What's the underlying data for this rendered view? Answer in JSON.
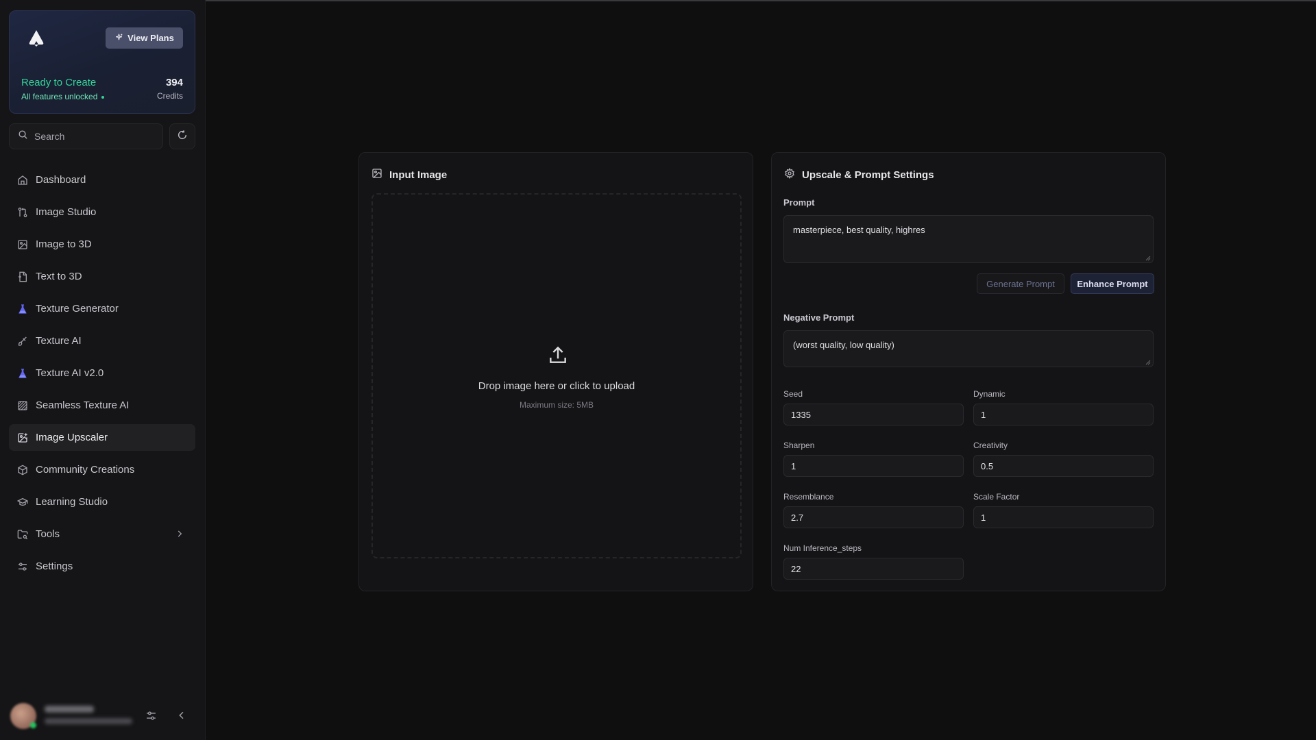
{
  "sidebar": {
    "plan": {
      "view_plans_label": "View Plans",
      "status_title": "Ready to Create",
      "status_sub": "All features unlocked",
      "credits_value": "394",
      "credits_label": "Credits"
    },
    "search": {
      "placeholder": "Search"
    },
    "items": [
      {
        "label": "Dashboard",
        "icon": "home-icon"
      },
      {
        "label": "Image Studio",
        "icon": "git-compare-icon"
      },
      {
        "label": "Image to 3D",
        "icon": "image-plus-icon"
      },
      {
        "label": "Text to 3D",
        "icon": "file-icon"
      },
      {
        "label": "Texture Generator",
        "icon": "flask-icon"
      },
      {
        "label": "Texture AI",
        "icon": "brush-icon"
      },
      {
        "label": "Texture AI v2.0",
        "icon": "flask-icon"
      },
      {
        "label": "Seamless Texture AI",
        "icon": "texture-icon"
      },
      {
        "label": "Image Upscaler",
        "icon": "image-plus-icon",
        "active": true
      },
      {
        "label": "Community Creations",
        "icon": "box-icon"
      },
      {
        "label": "Learning Studio",
        "icon": "graduation-cap-icon"
      },
      {
        "label": "Tools",
        "icon": "folder-search-icon",
        "has_submenu": true
      },
      {
        "label": "Settings",
        "icon": "sliders-icon"
      }
    ]
  },
  "input_panel": {
    "title": "Input Image",
    "drop_text": "Drop image here or click to upload",
    "drop_sub": "Maximum size: 5MB"
  },
  "settings_panel": {
    "title": "Upscale & Prompt Settings",
    "prompt_label": "Prompt",
    "prompt_value": "masterpiece, best quality, highres",
    "generate_prompt_label": "Generate Prompt",
    "enhance_prompt_label": "Enhance Prompt",
    "negative_prompt_label": "Negative Prompt",
    "negative_prompt_value": "(worst quality, low quality)",
    "fields": {
      "seed": {
        "label": "Seed",
        "value": "1335"
      },
      "dynamic": {
        "label": "Dynamic",
        "value": "1"
      },
      "sharpen": {
        "label": "Sharpen",
        "value": "1"
      },
      "creativity": {
        "label": "Creativity",
        "value": "0.5"
      },
      "resemblance": {
        "label": "Resemblance",
        "value": "2.7"
      },
      "scale_factor": {
        "label": "Scale Factor",
        "value": "1"
      },
      "num_inference_steps": {
        "label": "Num Inference_steps",
        "value": "22"
      }
    }
  },
  "colors": {
    "accent_green": "#34d399",
    "accent_indigo": "#343a5c",
    "background": "#0f0f10",
    "panel": "#141416"
  }
}
